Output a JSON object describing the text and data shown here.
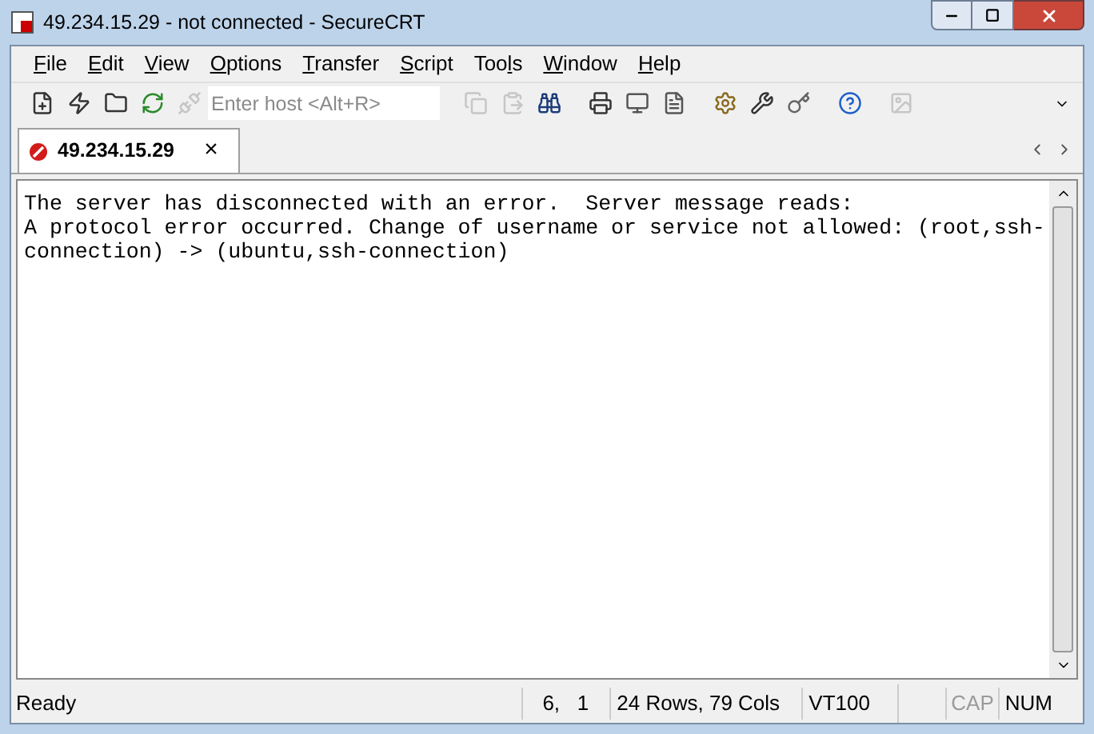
{
  "window": {
    "title": "49.234.15.29 - not connected - SecureCRT"
  },
  "menu": [
    {
      "key": "F",
      "after": "ile"
    },
    {
      "key": "E",
      "after": "dit"
    },
    {
      "key": "V",
      "after": "iew"
    },
    {
      "key": "O",
      "after": "ptions"
    },
    {
      "key": "T",
      "after": "ransfer"
    },
    {
      "key": "S",
      "after": "cript"
    },
    {
      "before": "Too",
      "key": "l",
      "after": "s"
    },
    {
      "key": "W",
      "after": "indow"
    },
    {
      "key": "H",
      "after": "elp"
    }
  ],
  "toolbar": {
    "host_field": {
      "placeholder": "Enter host <Alt+R>"
    }
  },
  "tabs": [
    {
      "label": "49.234.15.29",
      "selected": true,
      "close": "×"
    }
  ],
  "terminal": {
    "lines": [
      "The server has disconnected with an error.  Server message reads:",
      "A protocol error occurred. Change of username or service not allowed: (root,ssh-",
      "connection) -> (ubuntu,ssh-connection)"
    ]
  },
  "status_bar": {
    "message": "Ready",
    "position": "6,   1",
    "size": "24 Rows, 79 Cols",
    "emulation": "VT100",
    "indicators": [
      {
        "label": "CAP",
        "on": false
      },
      {
        "label": "NUM",
        "on": true
      }
    ]
  }
}
